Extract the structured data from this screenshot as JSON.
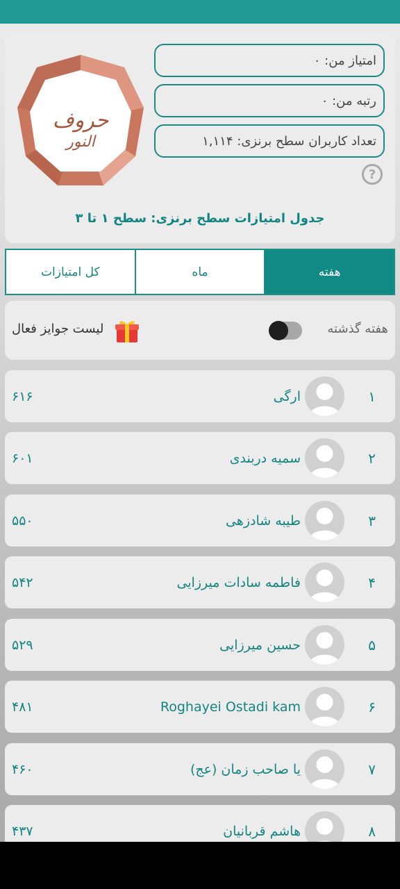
{
  "header": {
    "my_score": "امتیاز من: ۰",
    "my_rank": "رتبه من: ۰",
    "bronze_users": "تعداد کاربران سطح برنزی: ۱,۱۱۴",
    "help": "?",
    "table_title": "جدول امتیازات سطح برنزی: سطح ۱ تا ۳",
    "badge_icon": "bronze-hexagon-calligraphy"
  },
  "tabs": [
    "کل امتیازات",
    "ماه",
    "هفته"
  ],
  "active_tab": "هفته",
  "options": {
    "previous_week_label": "هفته گذشته",
    "previous_week_enabled": false,
    "prizes_label": "لیست جوایز فعال"
  },
  "leaderboard": [
    {
      "rank": "۱",
      "name": "ارگی",
      "score": "۶۱۶"
    },
    {
      "rank": "۲",
      "name": "سمیه دربندی",
      "score": "۶۰۱"
    },
    {
      "rank": "۳",
      "name": "طیبه شادزهی",
      "score": "۵۵۰"
    },
    {
      "rank": "۴",
      "name": "فاطمه سادات میرزایی",
      "score": "۵۴۲"
    },
    {
      "rank": "۵",
      "name": "حسین میرزایی",
      "score": "۵۲۹"
    },
    {
      "rank": "۶",
      "name": "Roghayei Ostadi kam",
      "score": "۴۸۱"
    },
    {
      "rank": "۷",
      "name": "یا صاحب زمان (عج)",
      "score": "۴۶۰"
    },
    {
      "rank": "۸",
      "name": "هاشم قربانیان",
      "score": "۴۳۷"
    }
  ],
  "colors": {
    "accent": "#118a85",
    "text": "#13847f",
    "topbar": "#209893",
    "bronze": "#d98b73"
  }
}
